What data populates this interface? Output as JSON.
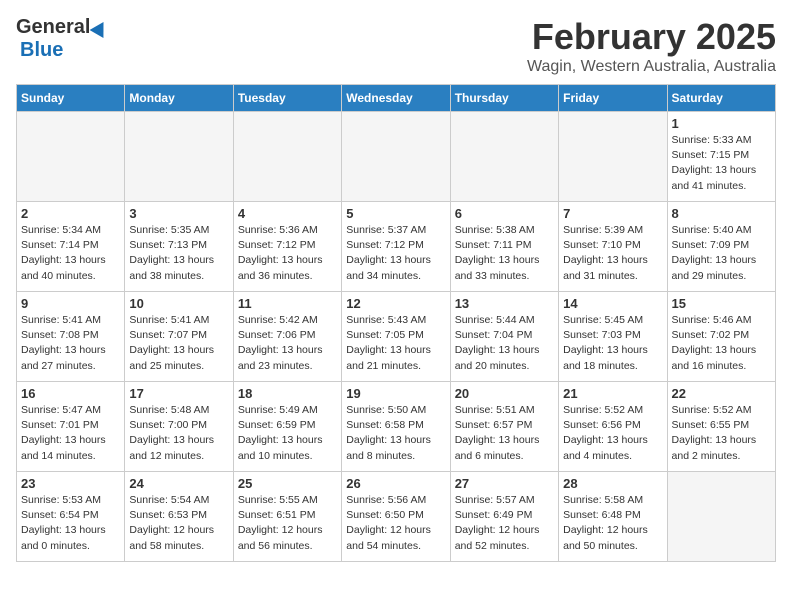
{
  "header": {
    "logo_general": "General",
    "logo_blue": "Blue",
    "title": "February 2025",
    "subtitle": "Wagin, Western Australia, Australia"
  },
  "columns": [
    "Sunday",
    "Monday",
    "Tuesday",
    "Wednesday",
    "Thursday",
    "Friday",
    "Saturday"
  ],
  "weeks": [
    [
      {
        "day": "",
        "info": ""
      },
      {
        "day": "",
        "info": ""
      },
      {
        "day": "",
        "info": ""
      },
      {
        "day": "",
        "info": ""
      },
      {
        "day": "",
        "info": ""
      },
      {
        "day": "",
        "info": ""
      },
      {
        "day": "1",
        "info": "Sunrise: 5:33 AM\nSunset: 7:15 PM\nDaylight: 13 hours\nand 41 minutes."
      }
    ],
    [
      {
        "day": "2",
        "info": "Sunrise: 5:34 AM\nSunset: 7:14 PM\nDaylight: 13 hours\nand 40 minutes."
      },
      {
        "day": "3",
        "info": "Sunrise: 5:35 AM\nSunset: 7:13 PM\nDaylight: 13 hours\nand 38 minutes."
      },
      {
        "day": "4",
        "info": "Sunrise: 5:36 AM\nSunset: 7:12 PM\nDaylight: 13 hours\nand 36 minutes."
      },
      {
        "day": "5",
        "info": "Sunrise: 5:37 AM\nSunset: 7:12 PM\nDaylight: 13 hours\nand 34 minutes."
      },
      {
        "day": "6",
        "info": "Sunrise: 5:38 AM\nSunset: 7:11 PM\nDaylight: 13 hours\nand 33 minutes."
      },
      {
        "day": "7",
        "info": "Sunrise: 5:39 AM\nSunset: 7:10 PM\nDaylight: 13 hours\nand 31 minutes."
      },
      {
        "day": "8",
        "info": "Sunrise: 5:40 AM\nSunset: 7:09 PM\nDaylight: 13 hours\nand 29 minutes."
      }
    ],
    [
      {
        "day": "9",
        "info": "Sunrise: 5:41 AM\nSunset: 7:08 PM\nDaylight: 13 hours\nand 27 minutes."
      },
      {
        "day": "10",
        "info": "Sunrise: 5:41 AM\nSunset: 7:07 PM\nDaylight: 13 hours\nand 25 minutes."
      },
      {
        "day": "11",
        "info": "Sunrise: 5:42 AM\nSunset: 7:06 PM\nDaylight: 13 hours\nand 23 minutes."
      },
      {
        "day": "12",
        "info": "Sunrise: 5:43 AM\nSunset: 7:05 PM\nDaylight: 13 hours\nand 21 minutes."
      },
      {
        "day": "13",
        "info": "Sunrise: 5:44 AM\nSunset: 7:04 PM\nDaylight: 13 hours\nand 20 minutes."
      },
      {
        "day": "14",
        "info": "Sunrise: 5:45 AM\nSunset: 7:03 PM\nDaylight: 13 hours\nand 18 minutes."
      },
      {
        "day": "15",
        "info": "Sunrise: 5:46 AM\nSunset: 7:02 PM\nDaylight: 13 hours\nand 16 minutes."
      }
    ],
    [
      {
        "day": "16",
        "info": "Sunrise: 5:47 AM\nSunset: 7:01 PM\nDaylight: 13 hours\nand 14 minutes."
      },
      {
        "day": "17",
        "info": "Sunrise: 5:48 AM\nSunset: 7:00 PM\nDaylight: 13 hours\nand 12 minutes."
      },
      {
        "day": "18",
        "info": "Sunrise: 5:49 AM\nSunset: 6:59 PM\nDaylight: 13 hours\nand 10 minutes."
      },
      {
        "day": "19",
        "info": "Sunrise: 5:50 AM\nSunset: 6:58 PM\nDaylight: 13 hours\nand 8 minutes."
      },
      {
        "day": "20",
        "info": "Sunrise: 5:51 AM\nSunset: 6:57 PM\nDaylight: 13 hours\nand 6 minutes."
      },
      {
        "day": "21",
        "info": "Sunrise: 5:52 AM\nSunset: 6:56 PM\nDaylight: 13 hours\nand 4 minutes."
      },
      {
        "day": "22",
        "info": "Sunrise: 5:52 AM\nSunset: 6:55 PM\nDaylight: 13 hours\nand 2 minutes."
      }
    ],
    [
      {
        "day": "23",
        "info": "Sunrise: 5:53 AM\nSunset: 6:54 PM\nDaylight: 13 hours\nand 0 minutes."
      },
      {
        "day": "24",
        "info": "Sunrise: 5:54 AM\nSunset: 6:53 PM\nDaylight: 12 hours\nand 58 minutes."
      },
      {
        "day": "25",
        "info": "Sunrise: 5:55 AM\nSunset: 6:51 PM\nDaylight: 12 hours\nand 56 minutes."
      },
      {
        "day": "26",
        "info": "Sunrise: 5:56 AM\nSunset: 6:50 PM\nDaylight: 12 hours\nand 54 minutes."
      },
      {
        "day": "27",
        "info": "Sunrise: 5:57 AM\nSunset: 6:49 PM\nDaylight: 12 hours\nand 52 minutes."
      },
      {
        "day": "28",
        "info": "Sunrise: 5:58 AM\nSunset: 6:48 PM\nDaylight: 12 hours\nand 50 minutes."
      },
      {
        "day": "",
        "info": ""
      }
    ]
  ]
}
